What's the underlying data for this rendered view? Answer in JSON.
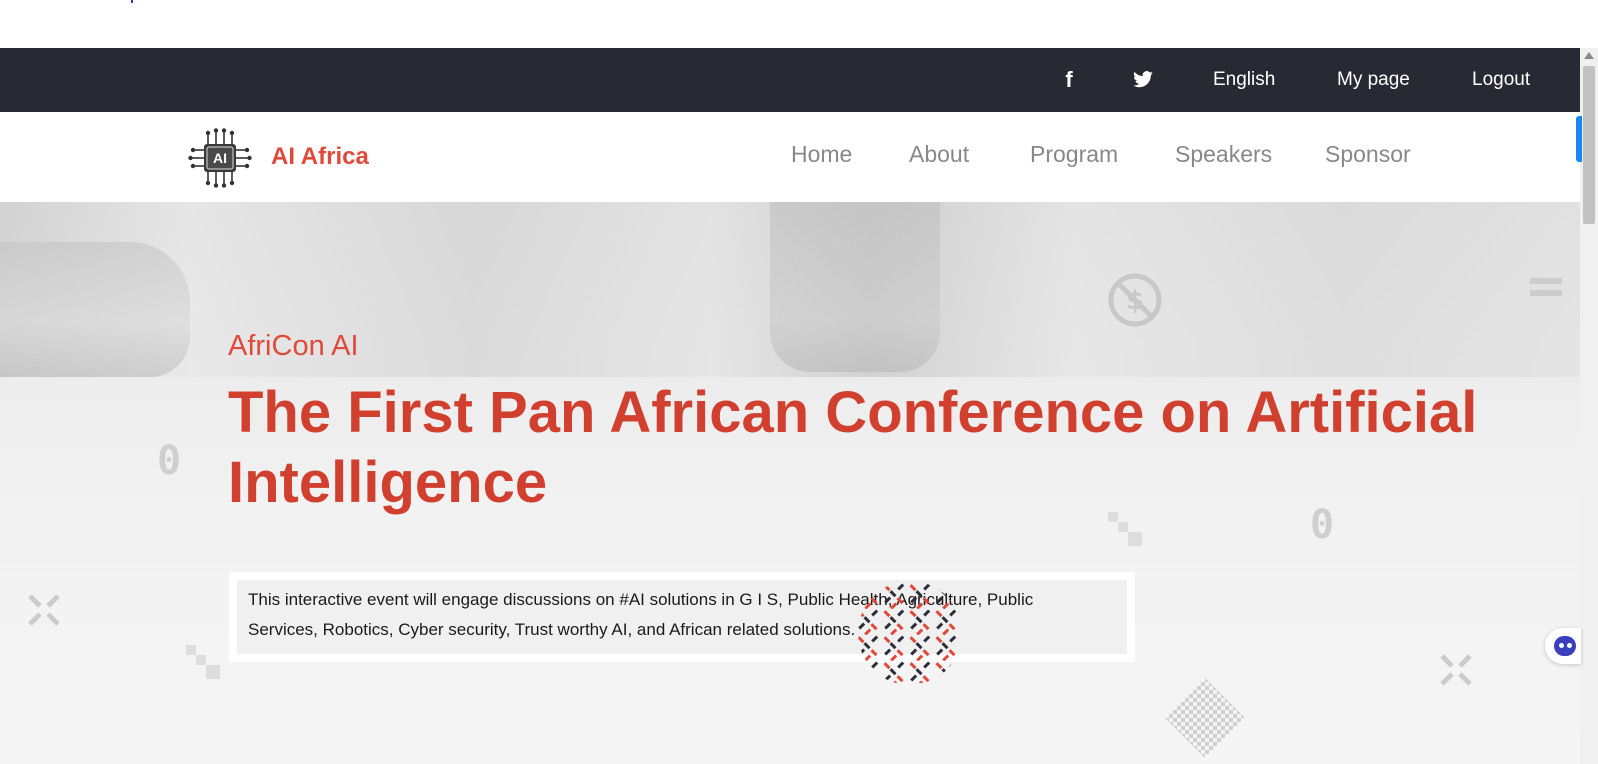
{
  "utility_bar": {
    "facebook_icon": "f",
    "language": "English",
    "my_page": "My page",
    "logout": "Logout"
  },
  "brand": {
    "logo_text": "AI",
    "name": "AI Africa"
  },
  "nav": {
    "items": [
      "Home",
      "About",
      "Program",
      "Speakers",
      "Sponsor"
    ]
  },
  "hero": {
    "subtitle": "AfriCon AI",
    "headline": "The First Pan African Conference on Artificial Intelligence",
    "description": "This interactive event will engage discussions on #AI solutions in G I S, Public Health, Agriculture, Public Services, Robotics, Cyber security, Trust worthy AI, and African related solutions.",
    "zero_glyph": "0"
  },
  "colors": {
    "accent": "#d1402f",
    "brand_red": "#e04a3b",
    "topbar_bg": "#282a33",
    "nav_text": "#888888",
    "pattern_dark": "#2b2d3a"
  },
  "icons": [
    "facebook-icon",
    "twitter-icon",
    "ai-chip-logo-icon",
    "no-dollar-icon",
    "menu-lines-icon",
    "x-cross-icon",
    "chat-bot-icon"
  ]
}
